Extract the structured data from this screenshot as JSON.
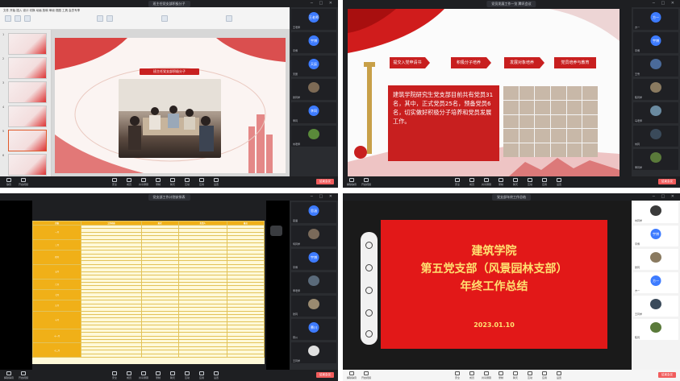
{
  "q1": {
    "window_title": "班主任党支部积极分子",
    "ribbon_menu": "文件  开始  插入  设计  切换  动画  放映  审阅  视图  工具  会员专享",
    "slide_title": "班主任党支部积极分子",
    "thumb_numbers": [
      "1",
      "2",
      "3",
      "4",
      "5",
      "6"
    ],
    "participants": [
      {
        "label": "王老师",
        "color": "#3d7bff",
        "name": "王老师"
      },
      {
        "label": "宇博",
        "color": "#3d7bff",
        "name": "宇博"
      },
      {
        "label": "天辰",
        "color": "#3d7bff",
        "name": "天辰"
      },
      {
        "label": "",
        "color": "#7d6a55",
        "name": "张同学"
      },
      {
        "label": "李同",
        "color": "#3d7bff",
        "name": "李同"
      },
      {
        "label": "",
        "color": "#5a8a3a",
        "name": "刘老师"
      }
    ],
    "toolbar": [
      "静音",
      "开启视频",
      "安全",
      "成员",
      "共享屏幕",
      "录制",
      "聊天",
      "互动",
      "应用",
      "设置"
    ],
    "end_label": "结束会议"
  },
  "q2": {
    "window_title": "党员发展工作一览 腾讯会议",
    "tabs": [
      "提交入党申请书",
      "积极分子培养",
      "发展对象培养",
      "党员培养与教育"
    ],
    "body_text": "建筑学院研究生党支部目前共有党员31名，其中，正式党员25名，预备党员6名，切实做好积极分子培养和党员发展工作。",
    "participants": [
      {
        "label": "方一",
        "color": "#3d7bff",
        "name": "方一"
      },
      {
        "label": "宇博",
        "color": "#3d7bff",
        "name": "宇博"
      },
      {
        "label": "",
        "color": "#4a6a9a",
        "name": "王雪"
      },
      {
        "label": "",
        "color": "#8a7a60",
        "name": "陈同学"
      },
      {
        "label": "",
        "color": "#6a8aa0",
        "name": "马老师"
      },
      {
        "label": "",
        "color": "#3a4a5a",
        "name": "刘同"
      },
      {
        "label": "",
        "color": "#5a7a3a",
        "name": "李同学"
      }
    ],
    "toolbar": [
      "解除静音",
      "开启视频",
      "安全",
      "成员",
      "共享屏幕",
      "录制",
      "聊天",
      "互动",
      "应用",
      "设置"
    ],
    "end_label": "结束会议"
  },
  "q3": {
    "window_title": "党支部工作计划安排表",
    "header": [
      "月份",
      "工作内容",
      "形式",
      "负责人",
      "备注"
    ],
    "categories": [
      "一月",
      "三月",
      "四月",
      "五月",
      "六月",
      "七月",
      "九月",
      "十月",
      "十一月",
      "十二月"
    ],
    "participants": [
      {
        "label": "思涵",
        "color": "#3d7bff",
        "name": "思涵"
      },
      {
        "label": "",
        "color": "#7a6a5a",
        "name": "何同学"
      },
      {
        "label": "宇博",
        "color": "#3d7bff",
        "name": "宇博"
      },
      {
        "label": "",
        "color": "#5a6a7a",
        "name": "李老师"
      },
      {
        "label": "",
        "color": "#9a8a70",
        "name": "张同"
      },
      {
        "label": "慕川",
        "color": "#3d7bff",
        "name": "慕川"
      },
      {
        "label": "",
        "color": "#e0e0e0",
        "name": "王同学"
      }
    ],
    "toolbar": [
      "解除静音",
      "开启视频",
      "安全",
      "成员",
      "共享屏幕",
      "录制",
      "聊天",
      "互动",
      "应用",
      "设置"
    ],
    "end_label": "结束会议"
  },
  "q4": {
    "window_title": "党支部年终工作总结",
    "title_line1": "建筑学院",
    "title_line2": "第五党支部（风景园林支部）",
    "title_line3": "年终工作总结",
    "date": "2023.01.10",
    "participants": [
      {
        "label": "",
        "color": "#3a3a3a",
        "name": "刘同学"
      },
      {
        "label": "宇博",
        "color": "#3d7bff",
        "name": "宇博"
      },
      {
        "label": "",
        "color": "#8a7a60",
        "name": "张同"
      },
      {
        "label": "方一",
        "color": "#3d7bff",
        "name": "方一"
      },
      {
        "label": "",
        "color": "#3a4a5a",
        "name": "王同学"
      },
      {
        "label": "",
        "color": "#5a7a3a",
        "name": "陈同"
      }
    ],
    "toolbar": [
      "解除静音",
      "开启视频",
      "安全",
      "成员",
      "共享屏幕",
      "录制",
      "聊天",
      "互动",
      "应用",
      "设置"
    ],
    "end_label": "结束会议"
  }
}
